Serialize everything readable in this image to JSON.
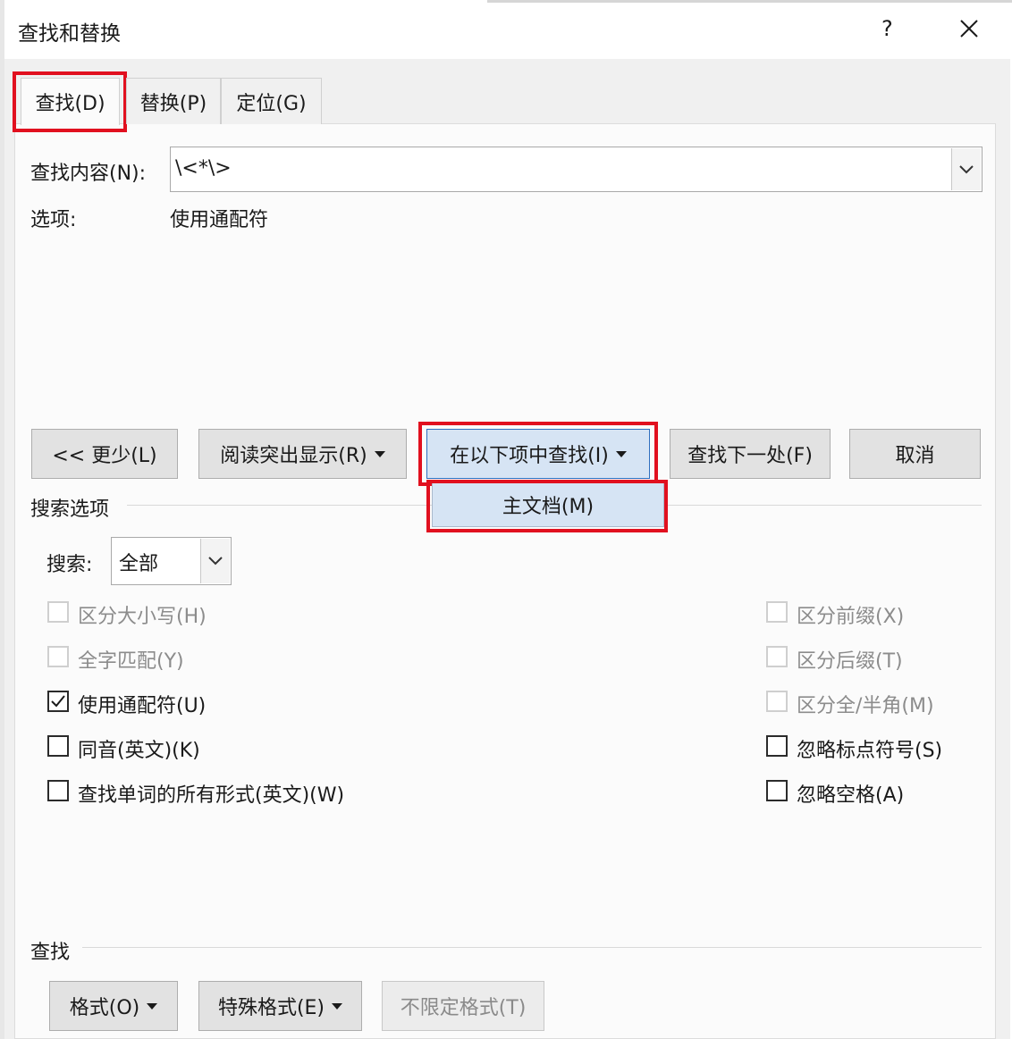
{
  "window": {
    "title": "查找和替换",
    "help_label": "?",
    "close_icon": "close-icon"
  },
  "tabs": [
    {
      "label": "查找(D)",
      "active": true
    },
    {
      "label": "替换(P)",
      "active": false
    },
    {
      "label": "定位(G)",
      "active": false
    }
  ],
  "find": {
    "label": "查找内容(N):",
    "value": "\\<*\\>",
    "options_label": "选项:",
    "options_value": "使用通配符"
  },
  "buttons": {
    "less": "<< 更少(L)",
    "reading_highlight": "阅读突出显示(R)",
    "find_in": "在以下项中查找(I)",
    "find_next": "查找下一处(F)",
    "cancel": "取消"
  },
  "find_in_menu": {
    "item": "主文档(M)"
  },
  "search_options": {
    "section_label": "搜索选项",
    "search_label": "搜索:",
    "search_value": "全部",
    "left": [
      {
        "label": "区分大小写(H)",
        "checked": false,
        "disabled": true
      },
      {
        "label": "全字匹配(Y)",
        "checked": false,
        "disabled": true
      },
      {
        "label": "使用通配符(U)",
        "checked": true,
        "disabled": false
      },
      {
        "label": "同音(英文)(K)",
        "checked": false,
        "disabled": false
      },
      {
        "label": "查找单词的所有形式(英文)(W)",
        "checked": false,
        "disabled": false
      }
    ],
    "right": [
      {
        "label": "区分前缀(X)",
        "checked": false,
        "disabled": true
      },
      {
        "label": "区分后缀(T)",
        "checked": false,
        "disabled": true
      },
      {
        "label": "区分全/半角(M)",
        "checked": false,
        "disabled": true
      },
      {
        "label": "忽略标点符号(S)",
        "checked": false,
        "disabled": false
      },
      {
        "label": "忽略空格(A)",
        "checked": false,
        "disabled": false
      }
    ]
  },
  "find_section": {
    "label": "查找",
    "format": "格式(O)",
    "special": "特殊格式(E)",
    "no_format": "不限定格式(T)"
  },
  "colors": {
    "highlight_red": "#e1101f",
    "selected_blue": "#d6e4f4"
  }
}
